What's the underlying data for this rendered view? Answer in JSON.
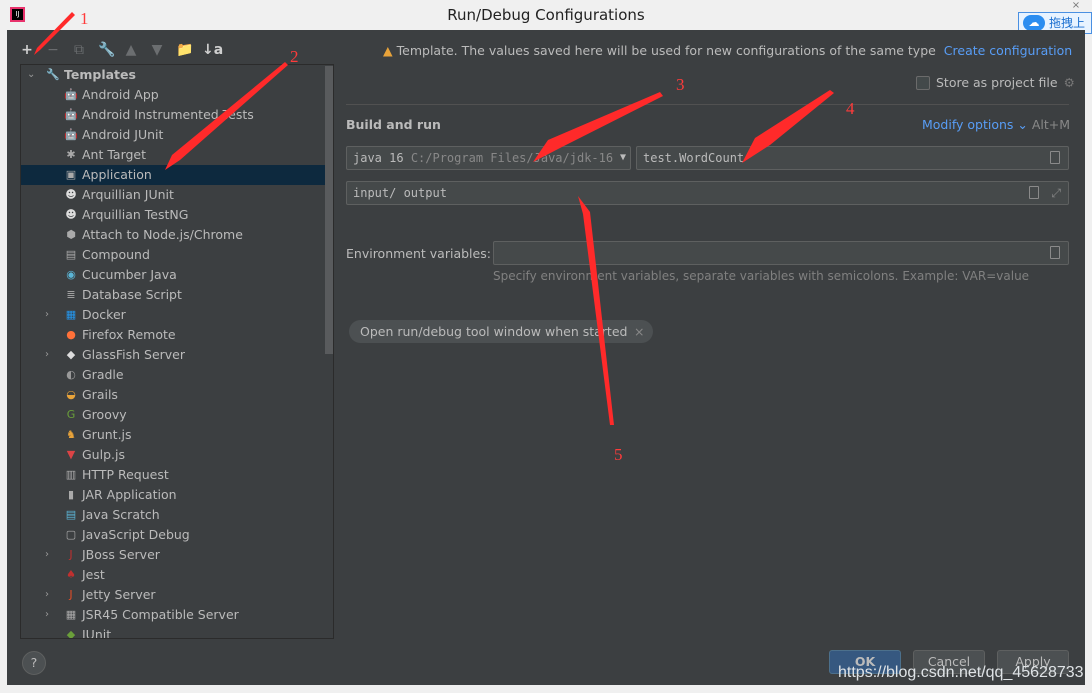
{
  "window": {
    "title": "Run/Debug Configurations",
    "close": "×"
  },
  "overlay_badge": "拖拽上",
  "toolbar": [
    "+",
    "−",
    "⧉",
    "🔧",
    "▲",
    "▼",
    "📁",
    "↓a"
  ],
  "tree": {
    "root": "Templates",
    "items": [
      {
        "label": "Android App",
        "icon": "android-icon",
        "color": "#3ddc84"
      },
      {
        "label": "Android Instrumented Tests",
        "icon": "android-icon",
        "color": "#3ddc84"
      },
      {
        "label": "Android JUnit",
        "icon": "android-icon",
        "color": "#3ddc84"
      },
      {
        "label": "Ant Target",
        "icon": "ant-icon",
        "color": "#aaaaaa"
      },
      {
        "label": "Application",
        "icon": "application-icon",
        "color": "#aaaaaa",
        "selected": true
      },
      {
        "label": "Arquillian JUnit",
        "icon": "alien-icon",
        "color": "#dddddd"
      },
      {
        "label": "Arquillian TestNG",
        "icon": "alien-icon",
        "color": "#dddddd"
      },
      {
        "label": "Attach to Node.js/Chrome",
        "icon": "nodejs-icon",
        "color": "#aaaaaa"
      },
      {
        "label": "Compound",
        "icon": "compound-icon",
        "color": "#aaaaaa"
      },
      {
        "label": "Cucumber Java",
        "icon": "cucumber-icon",
        "color": "#5bb5d6"
      },
      {
        "label": "Database Script",
        "icon": "database-icon",
        "color": "#aaaaaa"
      },
      {
        "label": "Docker",
        "icon": "docker-icon",
        "color": "#2496ed",
        "expandable": true
      },
      {
        "label": "Firefox Remote",
        "icon": "firefox-icon",
        "color": "#ff7139"
      },
      {
        "label": "GlassFish Server",
        "icon": "glassfish-icon",
        "color": "#dddddd",
        "expandable": true
      },
      {
        "label": "Gradle",
        "icon": "gradle-icon",
        "color": "#999999"
      },
      {
        "label": "Grails",
        "icon": "grails-icon",
        "color": "#e8a33a"
      },
      {
        "label": "Groovy",
        "icon": "groovy-icon",
        "color": "#6a9f3a"
      },
      {
        "label": "Grunt.js",
        "icon": "grunt-icon",
        "color": "#e8a33a"
      },
      {
        "label": "Gulp.js",
        "icon": "gulp-icon",
        "color": "#db4446"
      },
      {
        "label": "HTTP Request",
        "icon": "http-icon",
        "color": "#aaaaaa"
      },
      {
        "label": "JAR Application",
        "icon": "jar-icon",
        "color": "#aaaaaa"
      },
      {
        "label": "Java Scratch",
        "icon": "scratch-icon",
        "color": "#5bb5d6"
      },
      {
        "label": "JavaScript Debug",
        "icon": "js-debug-icon",
        "color": "#aaaaaa"
      },
      {
        "label": "JBoss Server",
        "icon": "jboss-icon",
        "color": "#c0302f",
        "expandable": true
      },
      {
        "label": "Jest",
        "icon": "jest-icon",
        "color": "#c0302f"
      },
      {
        "label": "Jetty Server",
        "icon": "jetty-icon",
        "color": "#e34c26",
        "expandable": true
      },
      {
        "label": "JSR45 Compatible Server",
        "icon": "jsr45-icon",
        "color": "#aaaaaa",
        "expandable": true
      },
      {
        "label": "JUnit",
        "icon": "junit-icon",
        "color": "#6a9f3a"
      }
    ]
  },
  "main": {
    "notice": "Template. The values saved here will be used for new configurations of the same type",
    "create_link": "Create configuration",
    "store_label": "Store as project file",
    "section": "Build and run",
    "modify_options": "Modify options",
    "modify_shortcut": "Alt+M",
    "jre": "java 16",
    "jre_path": "C:/Program Files/Java/jdk-16",
    "main_class": "test.WordCount",
    "program_args": "input/ output",
    "env_label": "Environment variables:",
    "env_value": "",
    "env_hint": "Specify environment variables, separate variables with semicolons. Example: VAR=value",
    "chip": "Open run/debug tool window when started"
  },
  "buttons": {
    "help": "?",
    "ok": "OK",
    "cancel": "Cancel",
    "apply": "Apply"
  },
  "watermark": "https://blog.csdn.net/qq_45628733",
  "annotations": [
    "1",
    "2",
    "3",
    "4",
    "5"
  ],
  "colors": {
    "background": "#3c3f41",
    "selection": "#0d293e",
    "link": "#589df6",
    "annotation": "#ff3b3b",
    "ok_button": "#365880"
  }
}
